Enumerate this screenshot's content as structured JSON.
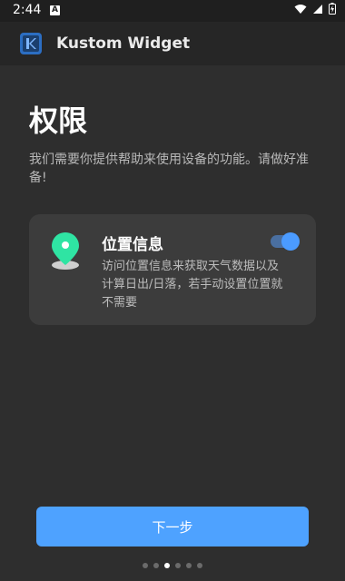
{
  "status_bar": {
    "time": "2:44",
    "notification_badge": "A",
    "icons": [
      "wifi-icon",
      "signal-icon",
      "battery-icon"
    ]
  },
  "app_bar": {
    "logo_icon": "kustom-logo-icon",
    "title": "Kustom Widget"
  },
  "page": {
    "title": "权限",
    "description": "我们需要你提供帮助来使用设备的功能。请做好准备!"
  },
  "permission_card": {
    "icon": "location-pin-icon",
    "title": "位置信息",
    "description": "访问位置信息来获取天气数据以及计算日出/日落，若手动设置位置就不需要",
    "toggle_on": true
  },
  "next_button": {
    "label": "下一步"
  },
  "pager": {
    "total": 6,
    "current": 3
  },
  "colors": {
    "accent": "#4ea2ff",
    "background": "#2e2e2e",
    "card": "#3c3c3c",
    "location_green": "#2fe4a3"
  }
}
